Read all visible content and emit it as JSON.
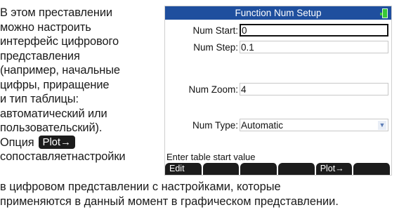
{
  "description": {
    "lines": [
      "В этом преставлении",
      "можно настроить",
      "интерфейс цифрового",
      "представления",
      "(например, начальные",
      "цифры, приращение",
      "и тип таблицы:",
      "автоматический или",
      "пользовательский).",
      "Опция"
    ],
    "key_label": "Plot→",
    "line_after_key": "сопоставляетнастройки",
    "full_lines": [
      "в цифровом представлении с настройками, которые",
      "применяются в данный момент в графическом представлении."
    ]
  },
  "screen": {
    "title": "Function Num Setup",
    "fields": [
      {
        "label": "Num Start:",
        "value": "0"
      },
      {
        "label": "Num Step:",
        "value": "0.1"
      },
      {
        "label": "Num Zoom:",
        "value": "4"
      },
      {
        "label": "Num Type:",
        "value": "Automatic"
      }
    ],
    "help": "Enter table start value",
    "softkeys": [
      "Edit",
      "",
      "",
      "",
      "Plot→",
      ""
    ]
  },
  "colors": {
    "titlebar": "#1f4f9e",
    "battery": "#37c837"
  }
}
